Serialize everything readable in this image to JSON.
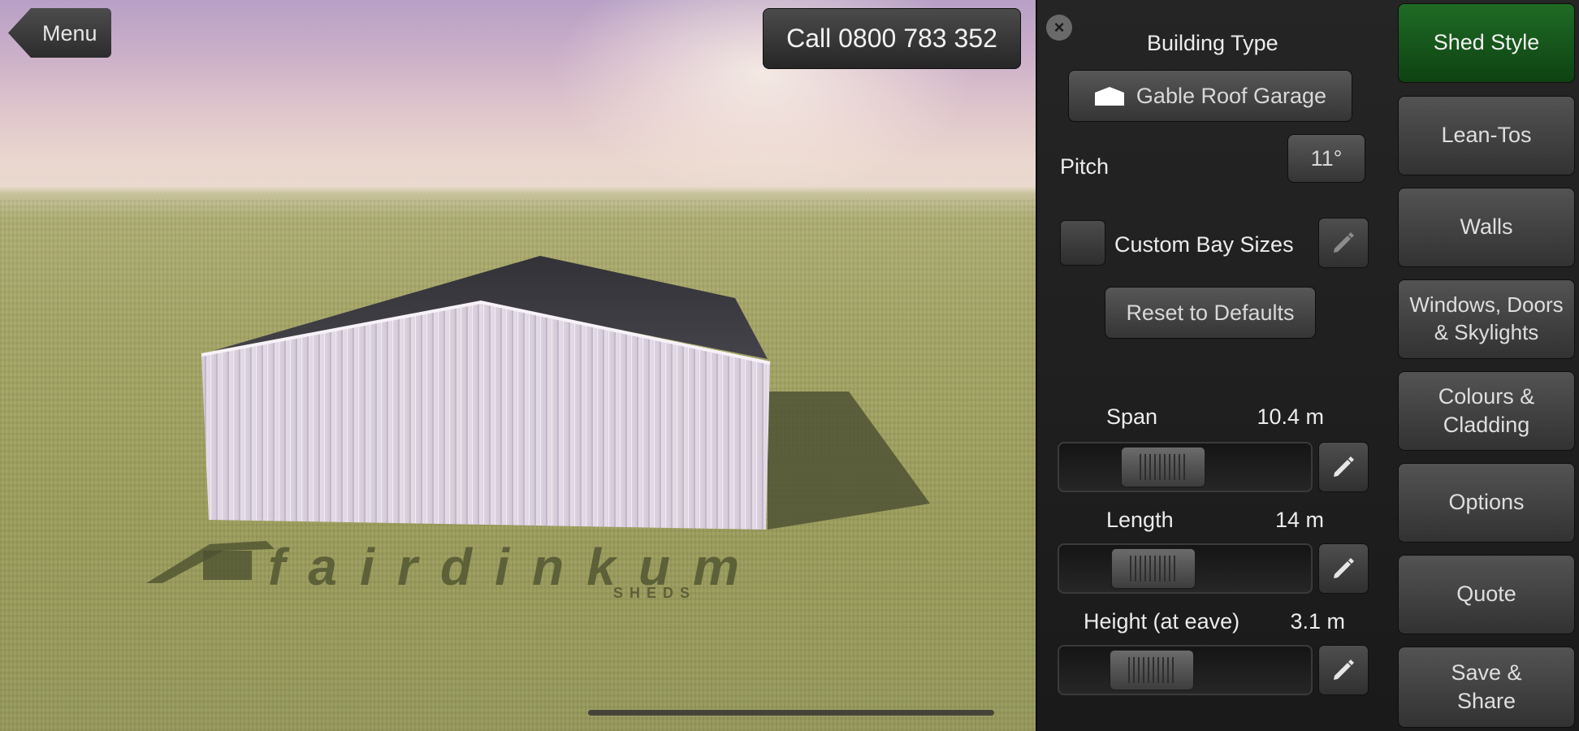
{
  "viewport": {
    "menu_label": "Menu",
    "call_label": "Call 0800 783 352",
    "logo_text": "fairdinkum",
    "logo_subtext": "SHEDS"
  },
  "panel": {
    "building_type_title": "Building Type",
    "building_type_value": "Gable Roof Garage",
    "pitch_label": "Pitch",
    "pitch_value": "11°",
    "custom_bay_label": "Custom Bay Sizes",
    "custom_bay_checked": false,
    "reset_label": "Reset to Defaults",
    "sliders": [
      {
        "label": "Span",
        "value": "10.4 m",
        "fraction": 0.37
      },
      {
        "label": "Length",
        "value": "14 m",
        "fraction": 0.31
      },
      {
        "label": "Height (at eave)",
        "value": "3.1 m",
        "fraction": 0.3
      }
    ]
  },
  "nav": {
    "items": [
      {
        "label": "Shed Style",
        "active": true
      },
      {
        "label": "Lean-Tos",
        "active": false
      },
      {
        "label": "Walls",
        "active": false
      },
      {
        "label": "Windows, Doors\n& Skylights",
        "active": false
      },
      {
        "label": "Colours &\nCladding",
        "active": false
      },
      {
        "label": "Options",
        "active": false
      },
      {
        "label": "Quote",
        "active": false
      },
      {
        "label": "Save &\nShare",
        "active": false
      }
    ]
  },
  "icons": {
    "close": "close-icon",
    "building": "garage-icon",
    "edit": "pencil-icon",
    "back": "back-arrow-icon"
  },
  "colors": {
    "active_nav": "#17561b",
    "panel_bg": "#1f1f1f",
    "shed_wall": "#ddd4e2",
    "shed_roof": "#3b3b40"
  }
}
